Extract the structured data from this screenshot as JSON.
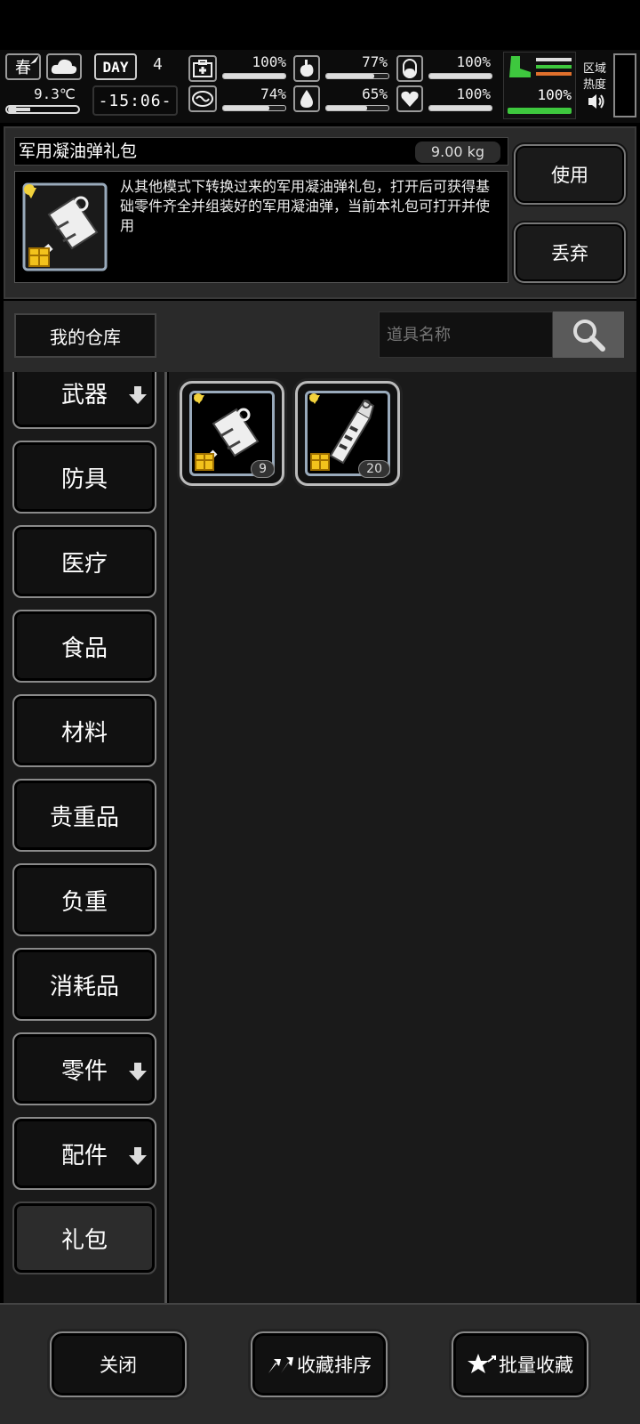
{
  "hud": {
    "season": "春",
    "temperature": "9.3℃",
    "day_label": "DAY",
    "day_number": "4",
    "time": "-15:06-",
    "stats": [
      {
        "name": "health",
        "value": "100%",
        "fill": 1.0
      },
      {
        "name": "stomach",
        "value": "77%",
        "fill": 0.77
      },
      {
        "name": "pill",
        "value": "100%",
        "fill": 1.0
      },
      {
        "name": "brain",
        "value": "74%",
        "fill": 0.74
      },
      {
        "name": "water",
        "value": "65%",
        "fill": 0.65
      },
      {
        "name": "heart",
        "value": "100%",
        "fill": 1.0
      }
    ],
    "stamina_value": "100%",
    "zone_heat_label_1": "区域",
    "zone_heat_label_2": "热度"
  },
  "detail": {
    "name": "军用凝油弹礼包",
    "weight": "9.00 kg",
    "description": "从其他模式下转换过来的军用凝油弹礼包，打开后可获得基础零件齐全并组装好的军用凝油弹，当前本礼包可打开并使用",
    "use_label": "使用",
    "discard_label": "丢弃"
  },
  "warehouse_label": "我的仓库",
  "search": {
    "placeholder": "道具名称"
  },
  "categories": [
    {
      "label": "武器",
      "arrow": true
    },
    {
      "label": "防具",
      "arrow": false
    },
    {
      "label": "医疗",
      "arrow": false
    },
    {
      "label": "食品",
      "arrow": false
    },
    {
      "label": "材料",
      "arrow": false
    },
    {
      "label": "贵重品",
      "arrow": false
    },
    {
      "label": "负重",
      "arrow": false
    },
    {
      "label": "消耗品",
      "arrow": false
    },
    {
      "label": "零件",
      "arrow": true
    },
    {
      "label": "配件",
      "arrow": true
    },
    {
      "label": "礼包",
      "arrow": false,
      "active": true
    }
  ],
  "items": [
    {
      "icon": "napalm-gift-icon",
      "count": "9"
    },
    {
      "icon": "grenade-gift-icon",
      "count": "20"
    }
  ],
  "bottom": {
    "close_label": "关闭",
    "sort_label": "收藏排序",
    "batch_label": "批量收藏"
  }
}
